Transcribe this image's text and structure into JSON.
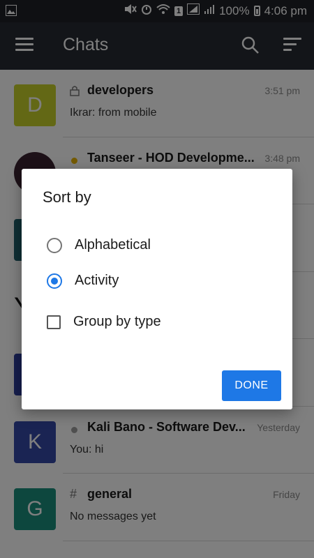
{
  "status_bar": {
    "battery": "100%",
    "time": "4:06 pm",
    "sim_slot": "1"
  },
  "toolbar": {
    "title": "Chats"
  },
  "chats": [
    {
      "name": "developers",
      "preview": "Ikrar: from mobile",
      "time": "3:51 pm",
      "avatar_letter": "D",
      "avatar_color": "#c6d12a",
      "status": "lock"
    },
    {
      "name": "Tanseer - HOD Developme...",
      "preview": "",
      "time": "3:48 pm",
      "avatar_letter": "",
      "avatar_color": "#3a2230",
      "status": "away"
    },
    {
      "name": "",
      "preview": "",
      "time": "",
      "avatar_letter": "",
      "avatar_color": "#1f5e6a",
      "status": ""
    },
    {
      "name": "",
      "preview": "",
      "time": "",
      "avatar_letter": "",
      "avatar_color": "#ffffff",
      "status": ""
    },
    {
      "name": "",
      "preview": "",
      "time": "",
      "avatar_letter": "",
      "avatar_color": "#2d3c9a",
      "status": ""
    },
    {
      "name": "Kali Bano - Software Dev...",
      "preview": "You: hi",
      "time": "Yesterday",
      "avatar_letter": "K",
      "avatar_color": "#3448a6",
      "status": "offline"
    },
    {
      "name": "general",
      "preview": "No messages yet",
      "time": "Friday",
      "avatar_letter": "G",
      "avatar_color": "#1b8f7c",
      "status": "hash"
    }
  ],
  "dialog": {
    "title": "Sort by",
    "options": [
      {
        "label": "Alphabetical",
        "type": "radio",
        "checked": false
      },
      {
        "label": "Activity",
        "type": "radio",
        "checked": true
      },
      {
        "label": "Group by type",
        "type": "checkbox",
        "checked": false
      }
    ],
    "done_label": "DONE"
  },
  "colors": {
    "accent": "#1e78e6",
    "toolbar": "#262a33",
    "statusbar": "#1f2127"
  }
}
